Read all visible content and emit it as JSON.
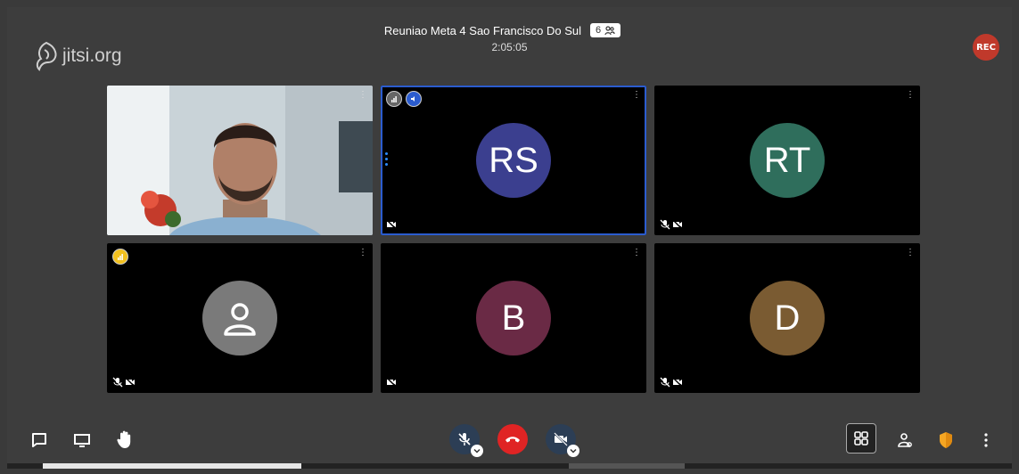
{
  "branding": {
    "logo_text": "jitsi.org",
    "logo_icon": "jitsi-logo-icon"
  },
  "header": {
    "title": "Reuniao Meta 4 Sao Francisco Do Sul",
    "participant_count": "6",
    "timer": "2:05:05"
  },
  "recording": {
    "label": "REC",
    "color": "#c0392b"
  },
  "tiles": [
    {
      "type": "video"
    },
    {
      "initials": "RS",
      "color": "#3b3f8f",
      "active": true
    },
    {
      "initials": "RT",
      "color": "#2f6e5c"
    },
    {
      "type": "placeholder",
      "color": "#7a7a7a"
    },
    {
      "initials": "B",
      "color": "#6a2a45"
    },
    {
      "initials": "D",
      "color": "#7a5b32"
    }
  ],
  "toolbar": {
    "left": [
      "chat-icon",
      "screenshare-icon",
      "raise-hand-icon"
    ],
    "center": [
      "microphone-muted-icon",
      "hangup-icon",
      "camera-off-icon"
    ],
    "right": [
      "tile-view-icon",
      "participants-icon",
      "security-shield-icon",
      "more-options-icon"
    ]
  },
  "colors": {
    "accent": "#2b5ccf",
    "hangup": "#e02424",
    "shield": "#f5a623"
  }
}
